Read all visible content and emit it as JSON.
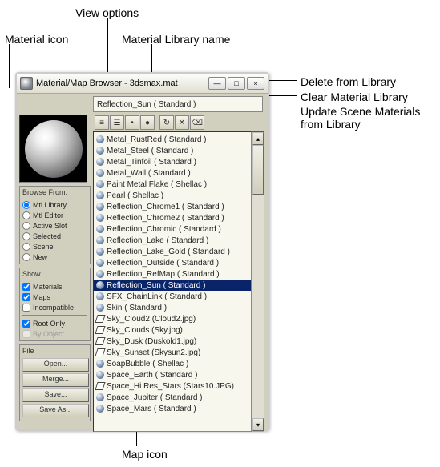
{
  "annotations": {
    "view_options": "View options",
    "material_icon": "Material icon",
    "material_library_name": "Material Library name",
    "delete_from_library": "Delete from Library",
    "clear_material_library": "Clear Material Library",
    "update_scene": "Update Scene Materials from Library",
    "map_icon": "Map icon"
  },
  "window": {
    "title": "Material/Map Browser - 3dsmax.mat",
    "selected_display": "Reflection_Sun  ( Standard )"
  },
  "browse_from": {
    "title": "Browse From:",
    "options": [
      {
        "label": "Mtl Library",
        "checked": true
      },
      {
        "label": "Mtl Editor",
        "checked": false
      },
      {
        "label": "Active Slot",
        "checked": false
      },
      {
        "label": "Selected",
        "checked": false
      },
      {
        "label": "Scene",
        "checked": false
      },
      {
        "label": "New",
        "checked": false
      }
    ]
  },
  "show": {
    "title": "Show",
    "options": [
      {
        "label": "Materials",
        "checked": true,
        "disabled": false
      },
      {
        "label": "Maps",
        "checked": true,
        "disabled": false
      },
      {
        "label": "Incompatible",
        "checked": false,
        "disabled": false
      }
    ],
    "options2": [
      {
        "label": "Root Only",
        "checked": true,
        "disabled": false
      },
      {
        "label": "By Object",
        "checked": false,
        "disabled": true
      }
    ]
  },
  "file": {
    "title": "File",
    "buttons": [
      "Open...",
      "Merge...",
      "Save...",
      "Save As..."
    ]
  },
  "toolbar_icons": [
    "view-list-small",
    "view-list",
    "view-icons-small",
    "view-icons-large",
    "update-scene",
    "delete-from-library",
    "clear-library"
  ],
  "list_items": [
    {
      "type": "mat",
      "label": "Metal_RustRed  ( Standard )"
    },
    {
      "type": "mat",
      "label": "Metal_Steel  ( Standard )"
    },
    {
      "type": "mat",
      "label": "Metal_Tinfoil  ( Standard )"
    },
    {
      "type": "mat",
      "label": "Metal_Wall  ( Standard )"
    },
    {
      "type": "mat",
      "label": "Paint Metal Flake  ( Shellac )"
    },
    {
      "type": "mat",
      "label": "Pearl  ( Shellac )"
    },
    {
      "type": "mat",
      "label": "Reflection_Chrome1  ( Standard )"
    },
    {
      "type": "mat",
      "label": "Reflection_Chrome2  ( Standard )"
    },
    {
      "type": "mat",
      "label": "Reflection_Chromic  ( Standard )"
    },
    {
      "type": "mat",
      "label": "Reflection_Lake  ( Standard )"
    },
    {
      "type": "mat",
      "label": "Reflection_Lake_Gold  ( Standard )"
    },
    {
      "type": "mat",
      "label": "Reflection_Outside  ( Standard )"
    },
    {
      "type": "mat",
      "label": "Reflection_RefMap  ( Standard )"
    },
    {
      "type": "mat",
      "label": "Reflection_Sun  ( Standard )",
      "selected": true
    },
    {
      "type": "mat",
      "label": "SFX_ChainLink  ( Standard )"
    },
    {
      "type": "mat",
      "label": "Skin  ( Standard )"
    },
    {
      "type": "map",
      "label": "Sky_Cloud2 (Cloud2.jpg)"
    },
    {
      "type": "map",
      "label": "Sky_Clouds (Sky.jpg)"
    },
    {
      "type": "map",
      "label": "Sky_Dusk (Duskold1.jpg)"
    },
    {
      "type": "map",
      "label": "Sky_Sunset (Skysun2.jpg)"
    },
    {
      "type": "mat",
      "label": "SoapBubble  ( Shellac )"
    },
    {
      "type": "mat",
      "label": "Space_Earth  ( Standard )"
    },
    {
      "type": "map",
      "label": "Space_Hi Res_Stars (Stars10.JPG)"
    },
    {
      "type": "mat",
      "label": "Space_Jupiter  ( Standard )"
    },
    {
      "type": "mat",
      "label": "Space_Mars  ( Standard )"
    }
  ]
}
